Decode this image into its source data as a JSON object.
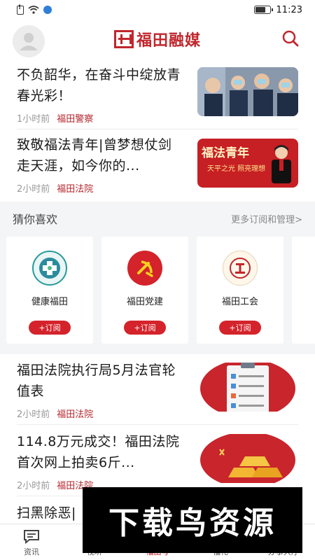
{
  "status_bar": {
    "time": "11:23"
  },
  "header": {
    "logo_text": "福田融媒"
  },
  "news_top": [
    {
      "title": "不负韶华，在奋斗中绽放青春光彩！",
      "time": "1小时前",
      "source": "福田警察"
    },
    {
      "title": "致敬福法青年|曾梦想仗剑走天涯，如今你的...",
      "time": "2小时前",
      "source": "福田法院",
      "thumb_text": "福法青年",
      "thumb_sub": "天平之光 照亮理想"
    }
  ],
  "guess": {
    "title": "猜你喜欢",
    "more_label": "更多订阅和管理>",
    "cards": [
      {
        "name": "健康福田",
        "button": "+订阅"
      },
      {
        "name": "福田党建",
        "button": "+订阅"
      },
      {
        "name": "福田工会",
        "button": "+订阅"
      }
    ]
  },
  "news_bottom": [
    {
      "title": "福田法院执行局5月法官轮值表",
      "time": "2小时前",
      "source": "福田法院"
    },
    {
      "title": "114.8万元成交！福田法院首次网上拍卖6斤...",
      "time": "2小时前",
      "source": "福田法院"
    },
    {
      "title": "扫黑除恶|"
    }
  ],
  "bottom_nav": [
    {
      "label": "资讯",
      "icon": "chat-icon"
    },
    {
      "label": "视听",
      "icon": "play-icon"
    },
    {
      "label": "福田号",
      "icon": "star-icon"
    },
    {
      "label": "福礼",
      "icon": "gift-icon"
    },
    {
      "label": "办事大厅",
      "icon": "service-icon"
    }
  ],
  "watermark": {
    "text": "下载鸟资源"
  },
  "colors": {
    "brand_red": "#c0272d",
    "button_red": "#d4232b",
    "source_red": "#b3272d"
  }
}
